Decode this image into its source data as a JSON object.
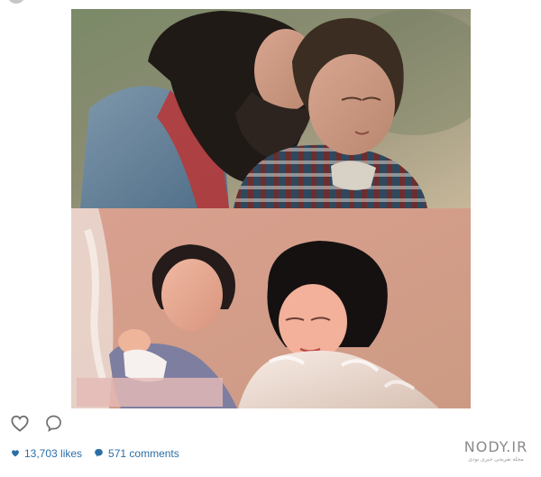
{
  "post": {
    "stats": {
      "likes": "13,703 likes",
      "comments": "571 comments"
    },
    "watermark": {
      "main": "NODY.IR",
      "sub": "مجله تفریحی خبری نودی"
    },
    "caption_fragment": ""
  },
  "icons": {
    "like": "heart-icon",
    "comment": "comment-icon",
    "likes_stat": "heart-icon",
    "comments_stat": "speech-bubble-icon"
  },
  "colors": {
    "link_blue": "#2b6ea6",
    "icon_gray": "#6f6f6f",
    "blur_pink": "#e4bab6"
  }
}
